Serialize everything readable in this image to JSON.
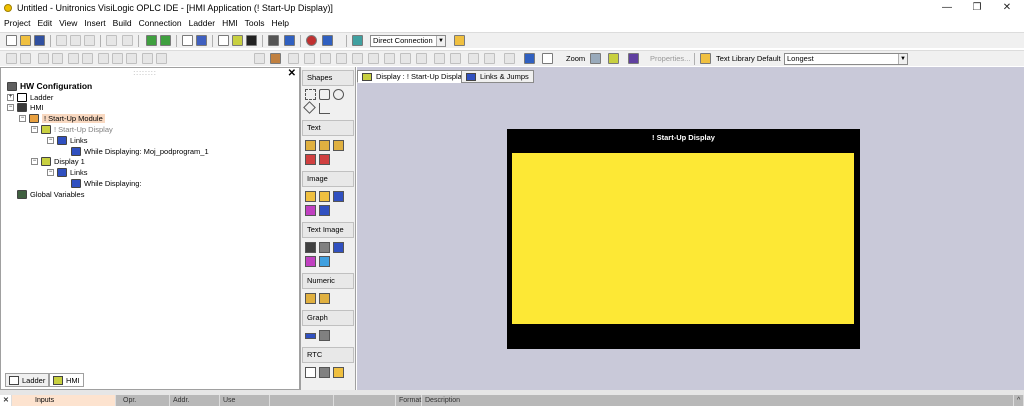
{
  "window": {
    "title": "Untitled - Unitronics VisiLogic OPLC IDE - [HMI Application (! Start-Up Display)]",
    "minimize": "—",
    "restore": "❐",
    "close": "✕"
  },
  "menu": [
    "Project",
    "Edit",
    "View",
    "Insert",
    "Build",
    "Connection",
    "Ladder",
    "HMI",
    "Tools",
    "Help"
  ],
  "toolbar": {
    "connection_value": "Direct Connection",
    "zoom_label": "Zoom",
    "properties_label": "Properties...",
    "text_library_label": "Text Library Default",
    "text_library_value": "Longest"
  },
  "tree": {
    "grip": "::::::::",
    "close": "✕",
    "root": "HW Configuration",
    "ladder": "Ladder",
    "hmi": "HMI",
    "startup_module": "! Start-Up Module",
    "startup_display": "! Start-Up Display",
    "links1": "Links",
    "while_displaying_1": "While Displaying:  Moj_podprogram_1",
    "display1": "Display 1",
    "links2": "Links",
    "while_displaying_2": "While Displaying:",
    "global_vars": "Global Variables",
    "tab_ladder": "Ladder",
    "tab_hmi": "HMI"
  },
  "palette": {
    "shapes": "Shapes",
    "text": "Text",
    "image": "Image",
    "text_image": "Text Image",
    "numeric": "Numeric",
    "graph": "Graph",
    "rtc": "RTC"
  },
  "canvas": {
    "tab_display": "Display : ! Start-Up Display",
    "tab_links": "Links & Jumps",
    "screen_title": "! Start-Up Display",
    "screen_color": "#fde835"
  },
  "bottom": {
    "close": "✕",
    "inputs": "Inputs",
    "opr": "Opr.",
    "addr": "Addr.",
    "use": "Use",
    "format": "Format",
    "description": "Description"
  }
}
